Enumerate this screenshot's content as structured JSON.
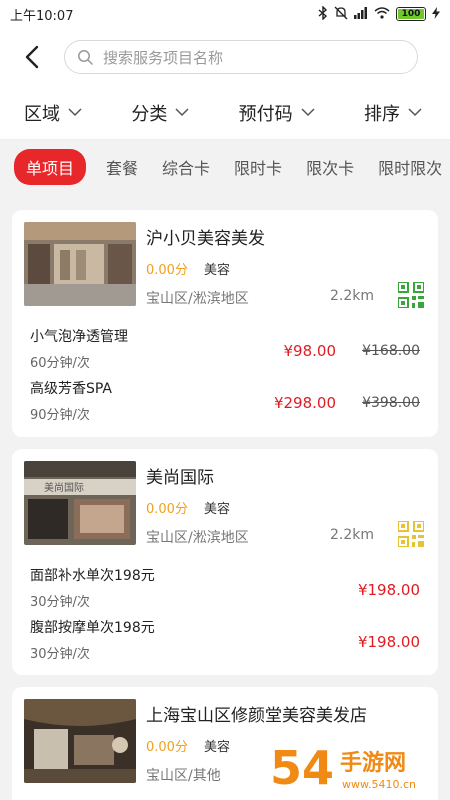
{
  "status_bar": {
    "time": "上午10:07",
    "battery": "100",
    "battery_level": 1.0
  },
  "search": {
    "placeholder": "搜索服务项目名称"
  },
  "filters": [
    {
      "label": "区域"
    },
    {
      "label": "分类"
    },
    {
      "label": "预付码"
    },
    {
      "label": "排序"
    }
  ],
  "tabs": [
    {
      "label": "单项目",
      "active": true
    },
    {
      "label": "套餐"
    },
    {
      "label": "综合卡"
    },
    {
      "label": "限时卡"
    },
    {
      "label": "限次卡"
    },
    {
      "label": "限时限次"
    }
  ],
  "stores": [
    {
      "name": "沪小贝美容美发",
      "rating": "0.00分",
      "category": "美容",
      "area": "宝山区/淞滨地区",
      "distance": "2.2km",
      "qr_color": "#3aa53a",
      "services": [
        {
          "name": "小气泡净透管理",
          "duration": "60分钟/次",
          "price": "¥98.00",
          "original_price": "¥168.00"
        },
        {
          "name": "高级芳香SPA",
          "duration": "90分钟/次",
          "price": "¥298.00",
          "original_price": "¥398.00"
        }
      ]
    },
    {
      "name": "美尚国际",
      "rating": "0.00分",
      "category": "美容",
      "area": "宝山区/淞滨地区",
      "distance": "2.2km",
      "qr_color": "#e8c235",
      "services": [
        {
          "name": "面部补水单次198元",
          "duration": "30分钟/次",
          "price": "¥198.00"
        },
        {
          "name": "腹部按摩单次198元",
          "duration": "30分钟/次",
          "price": "¥198.00"
        }
      ]
    },
    {
      "name": "上海宝山区修颜堂美容美发店",
      "rating": "0.00分",
      "category": "美容",
      "area": "宝山区/其他"
    }
  ],
  "watermark": {
    "digits": "54",
    "text": "手游网",
    "domain": "www.5410.cn",
    "color": "#f08a14"
  }
}
